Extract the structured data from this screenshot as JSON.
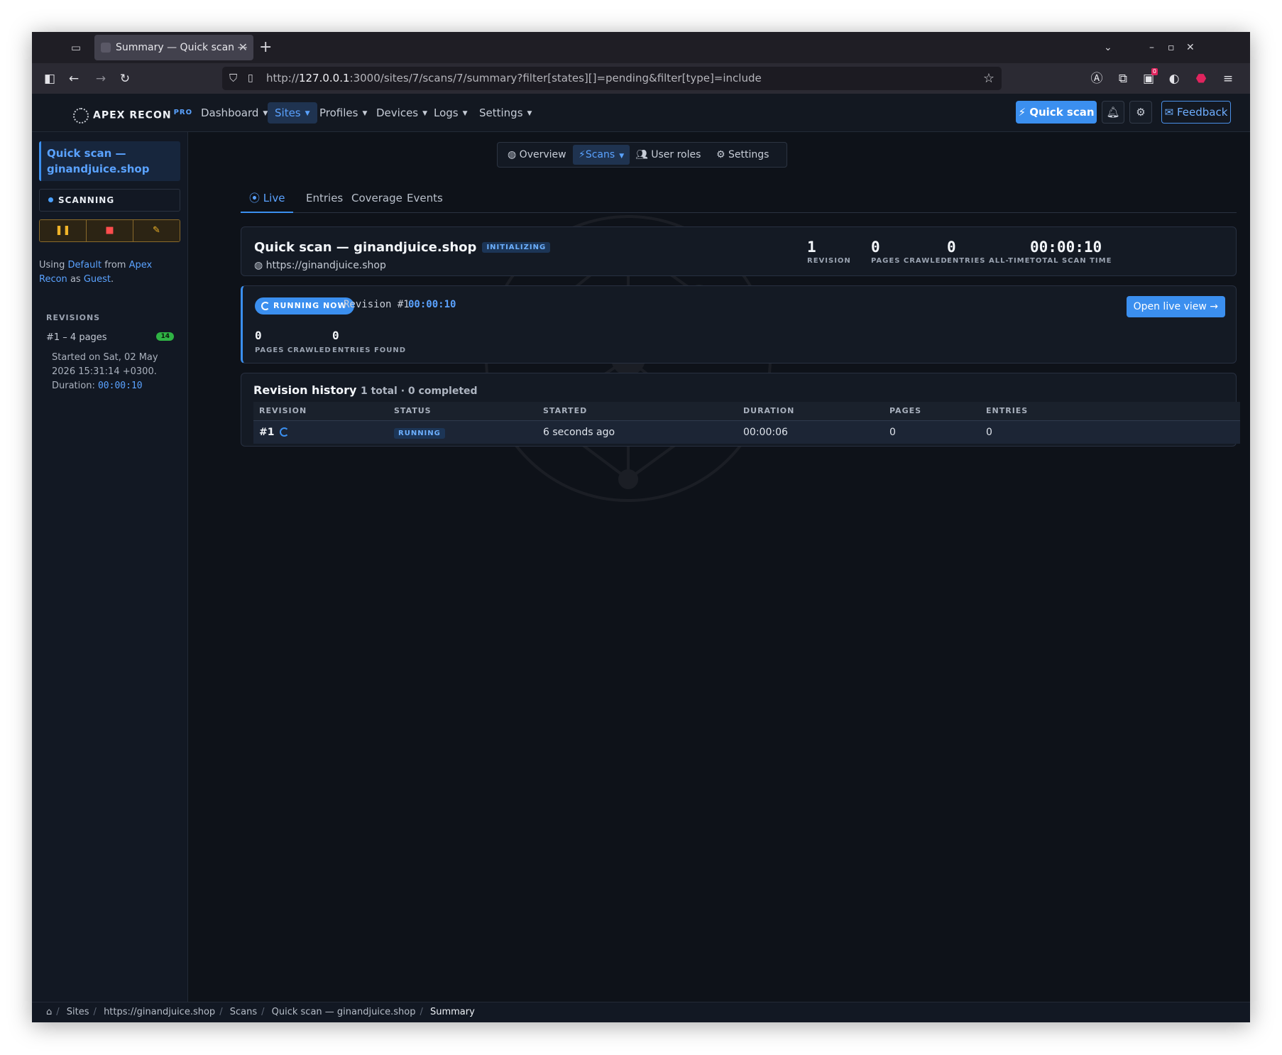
{
  "browser": {
    "tab_title": "Summary — Quick scan —",
    "url_prefix": "http://",
    "url_host": "127.0.0.1",
    "url_rest": ":3000/sites/7/scans/7/summary?filter[states][]=pending&filter[type]=include",
    "badge_count": "0"
  },
  "app": {
    "brand": "APEX RECON",
    "brand_tier": "PRO",
    "menu": [
      "Dashboard",
      "Sites",
      "Profiles",
      "Devices",
      "Logs",
      "Settings"
    ],
    "quick_scan": "Quick scan",
    "feedback": "Feedback"
  },
  "sidebar": {
    "title": "Quick scan — ginandjuice.shop",
    "status": "SCANNING",
    "using_prefix": "Using",
    "using_profile": "Default",
    "using_from": "from",
    "using_device": "Apex Recon",
    "using_as": "as",
    "using_user": "Guest",
    "revisions_heading": "REVISIONS",
    "revision_item": "#1 – 4 pages",
    "revision_badge": "14",
    "started": "Started on Sat, 02 May 2026 15:31:14 +0300.",
    "duration_label": "Duration:",
    "duration_value": "00:00:10"
  },
  "subnav": [
    "Overview",
    "Scans",
    "User roles",
    "Settings"
  ],
  "tabs": [
    "Live",
    "Entries",
    "Coverage",
    "Events"
  ],
  "summary": {
    "title": "Quick scan — ginandjuice.shop",
    "state": "INITIALIZING",
    "url": "https://ginandjuice.shop",
    "stats": [
      {
        "value": "1",
        "label": "REVISION"
      },
      {
        "value": "0",
        "label": "PAGES CRAWLED"
      },
      {
        "value": "0",
        "label": "ENTRIES ALL-TIME"
      },
      {
        "value": "00:00:10",
        "label": "TOTAL SCAN TIME"
      }
    ]
  },
  "running": {
    "pill": "RUNNING NOW",
    "revision": "Revision #1",
    "time": "00:00:10",
    "open_live": "Open live view",
    "stats": [
      {
        "value": "0",
        "label": "PAGES CRAWLED"
      },
      {
        "value": "0",
        "label": "ENTRIES FOUND"
      }
    ]
  },
  "history": {
    "title": "Revision history",
    "subtitle": "1 total · 0 completed",
    "columns": [
      "REVISION",
      "STATUS",
      "STARTED",
      "DURATION",
      "PAGES",
      "ENTRIES"
    ],
    "rows": [
      {
        "revision": "#1",
        "status": "RUNNING",
        "started": "6 seconds ago",
        "duration": "00:00:06",
        "pages": "0",
        "entries": "0"
      }
    ]
  },
  "breadcrumb": [
    "Sites",
    "https://ginandjuice.shop",
    "Scans",
    "Quick scan — ginandjuice.shop",
    "Summary"
  ],
  "colors": {
    "accent": "#3b8fef",
    "background": "#0e1219",
    "success": "#2fb344",
    "warning": "#f0b429",
    "danger": "#ff4d4d"
  }
}
